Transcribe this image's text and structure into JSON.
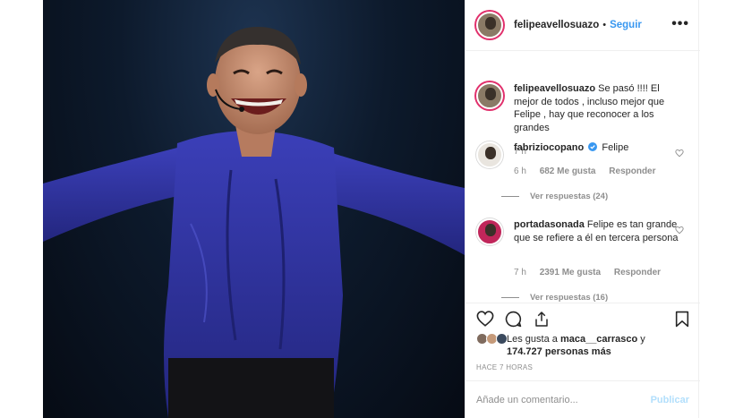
{
  "post": {
    "author": "felipeavellosuazo",
    "follow_label": "Seguir",
    "separator": "•",
    "more_label": "•••"
  },
  "caption": {
    "username": "felipeavellosuazo",
    "text": "Se pasó !!!! El mejor de todos , incluso mejor que Felipe , hay que reconocer a los grandes",
    "time": "7 h"
  },
  "comments": [
    {
      "username": "fabriziocopano",
      "verified": true,
      "text": "Felipe",
      "time": "6 h",
      "likes": "682 Me gusta",
      "reply_label": "Responder",
      "view_replies": "Ver respuestas (24)"
    },
    {
      "username": "portadasonada",
      "verified": false,
      "text": "Felipe es tan grande que se refiere a él en tercera persona",
      "time": "7 h",
      "likes": "2391 Me gusta",
      "reply_label": "Responder",
      "view_replies": "Ver respuestas (16)"
    }
  ],
  "actions": {
    "like_icon": "heart-icon",
    "comment_icon": "comment-icon",
    "share_icon": "share-icon",
    "save_icon": "bookmark-icon"
  },
  "likes": {
    "prefix": "Les gusta a",
    "user": "maca__carrasco",
    "connector": "y",
    "count": "174.727 personas más"
  },
  "timestamp": "HACE 7 HORAS",
  "comment_box": {
    "placeholder": "Añade un comentario...",
    "publish_label": "Publicar"
  },
  "colors": {
    "accent": "#3897f0",
    "publish_disabled": "#b2dffc",
    "verified": "#3897f0",
    "muted": "#8e8e8e",
    "photo_background": "#0d1a2c",
    "shirt": "#2c2f9a"
  }
}
